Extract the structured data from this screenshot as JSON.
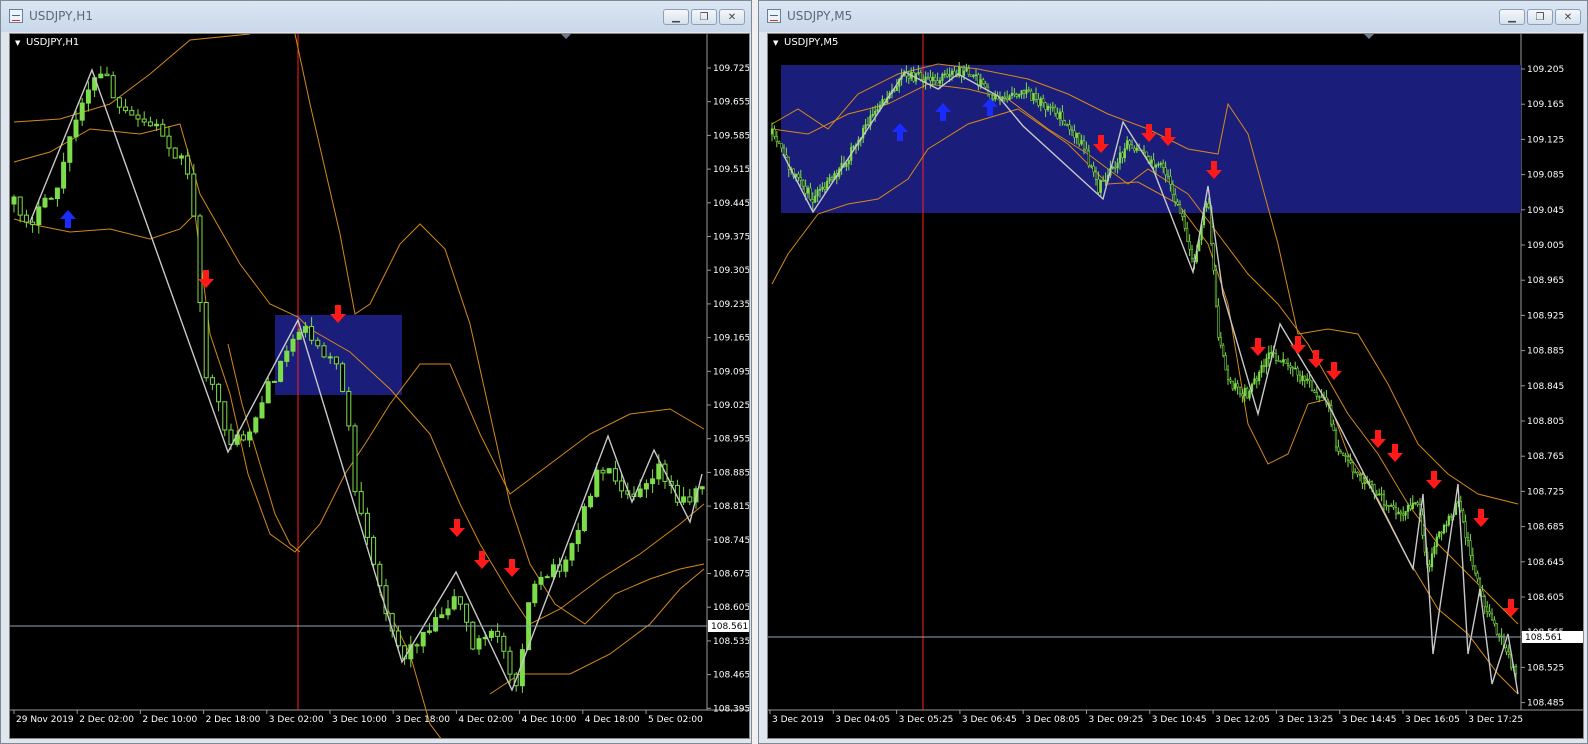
{
  "windows": [
    {
      "title": "USDJPY,H1",
      "symbol": "USDJPY,H1",
      "price_labels": [
        "109.725",
        "109.655",
        "109.585",
        "109.515",
        "109.445",
        "109.375",
        "109.305",
        "109.235",
        "109.165",
        "109.095",
        "109.025",
        "108.955",
        "108.885",
        "108.815",
        "108.745",
        "108.675",
        "108.605",
        "108.535",
        "108.465",
        "108.395"
      ],
      "current_price": "108.561",
      "time_labels": [
        "29 Nov 2019",
        "2 Dec 02:00",
        "2 Dec 10:00",
        "2 Dec 18:00",
        "3 Dec 02:00",
        "3 Dec 10:00",
        "3 Dec 18:00",
        "4 Dec 02:00",
        "4 Dec 10:00",
        "4 Dec 18:00",
        "5 Dec 02:00"
      ]
    },
    {
      "title": "USDJPY,M5",
      "symbol": "USDJPY,M5",
      "price_labels": [
        "109.205",
        "109.165",
        "109.125",
        "109.085",
        "109.045",
        "109.005",
        "108.965",
        "108.925",
        "108.885",
        "108.845",
        "108.805",
        "108.765",
        "108.725",
        "108.685",
        "108.645",
        "108.605",
        "108.565",
        "108.525",
        "108.485"
      ],
      "current_price": "108.561",
      "time_labels": [
        "3 Dec 2019",
        "3 Dec 04:05",
        "3 Dec 05:25",
        "3 Dec 06:45",
        "3 Dec 08:05",
        "3 Dec 09:25",
        "3 Dec 10:45",
        "3 Dec 12:05",
        "3 Dec 13:25",
        "3 Dec 14:45",
        "3 Dec 16:05",
        "3 Dec 17:25"
      ]
    }
  ],
  "colors": {
    "chart_bg": "#000000",
    "bull_candle": "#7ddc4a",
    "bear_candle": "#ffffff",
    "bands": "#d4891a",
    "zigzag": "#c8c8c8",
    "rectangle": "#1b1d7a",
    "vline": "#ff2020",
    "down_arrow": "#ff1a1a",
    "up_arrow": "#1a2bff"
  },
  "icons": {
    "minimize": "minimize-icon",
    "restore": "restore-icon",
    "close": "close-icon"
  }
}
